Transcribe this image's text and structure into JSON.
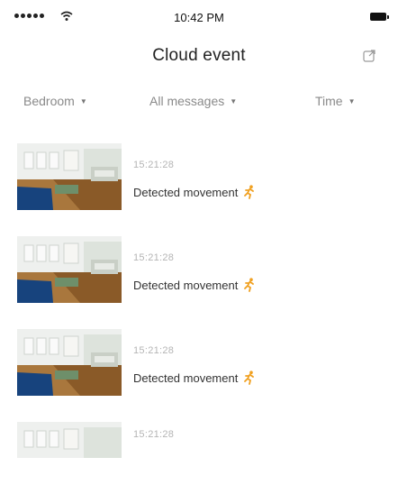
{
  "status_bar": {
    "time": "10:42 PM",
    "signal_icon": "signal-dots-icon",
    "wifi_icon": "wifi-icon",
    "battery_icon": "battery-icon"
  },
  "header": {
    "title": "Cloud event",
    "action_icon": "share-icon"
  },
  "filters": [
    {
      "label": "Bedroom",
      "icon": "caret-down-icon"
    },
    {
      "label": "All messages",
      "icon": "caret-down-icon"
    },
    {
      "label": "Time",
      "icon": "caret-down-icon"
    }
  ],
  "events": [
    {
      "time": "15:21:28",
      "message": "Detected movement",
      "icon": "running-person-icon"
    },
    {
      "time": "15:21:28",
      "message": "Detected movement",
      "icon": "running-person-icon"
    },
    {
      "time": "15:21:28",
      "message": "Detected movement",
      "icon": "running-person-icon"
    },
    {
      "time": "15:21:28",
      "message": "",
      "icon": ""
    }
  ],
  "colors": {
    "accent": "#f0a020",
    "timestamp": "#b5b5b5",
    "filter_text": "#8a8a8a"
  }
}
